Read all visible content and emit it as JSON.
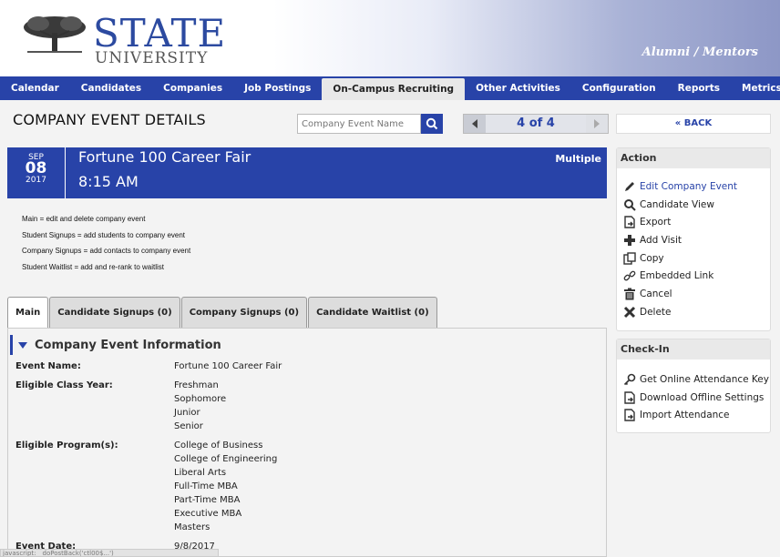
{
  "header": {
    "logo_main": "STATE",
    "logo_sub": "UNIVERSITY",
    "portal_name": "Alumni / Mentors"
  },
  "nav": {
    "items": [
      "Calendar",
      "Candidates",
      "Companies",
      "Job Postings",
      "On-Campus Recruiting",
      "Other Activities",
      "Configuration",
      "Reports",
      "Metrics"
    ],
    "active": "On-Campus Recruiting"
  },
  "page": {
    "title": "COMPANY EVENT DETAILS",
    "search_placeholder": "Company Event Name",
    "pager_text": "4 of 4",
    "back_label": "« BACK"
  },
  "event": {
    "month": "SEP",
    "day": "08",
    "year": "2017",
    "title": "Fortune 100 Career Fair",
    "time": "8:15 AM",
    "badge": "Multiple"
  },
  "legend": [
    "Main = edit and delete company event",
    "Student Signups = add students to company event",
    "Company Signups = add contacts to company event",
    "Student Waitlist = add and re-rank to waitlist"
  ],
  "tabs": [
    "Main",
    "Candidate Signups (0)",
    "Company Signups (0)",
    "Candidate Waitlist (0)"
  ],
  "section": {
    "title": "Company Event Information",
    "fields": {
      "event_name_label": "Event Name:",
      "event_name": "Fortune 100 Career Fair",
      "class_year_label": "Eligible Class Year:",
      "class_years": [
        "Freshman",
        "Sophomore",
        "Junior",
        "Senior"
      ],
      "programs_label": "Eligible Program(s):",
      "programs": [
        "College of Business",
        "College of Engineering",
        "Liberal Arts",
        "Full-Time MBA",
        "Part-Time MBA",
        "Executive MBA",
        "Masters"
      ],
      "event_date_label": "Event Date:",
      "event_date": "9/8/2017"
    }
  },
  "status_text": "javascript:__doPostBack('ctl00$...')",
  "action_panel": {
    "title": "Action",
    "items": [
      {
        "label": "Edit Company Event",
        "icon": "pencil-icon"
      },
      {
        "label": "Candidate View",
        "icon": "magnifier-icon"
      },
      {
        "label": "Export",
        "icon": "export-icon"
      },
      {
        "label": "Add Visit",
        "icon": "plus-icon"
      },
      {
        "label": "Copy",
        "icon": "copy-icon"
      },
      {
        "label": "Embedded Link",
        "icon": "link-icon"
      },
      {
        "label": "Cancel",
        "icon": "trash-icon"
      },
      {
        "label": "Delete",
        "icon": "x-icon"
      }
    ]
  },
  "checkin_panel": {
    "title": "Check-In",
    "items": [
      {
        "label": "Get Online Attendance Key",
        "icon": "key-icon"
      },
      {
        "label": "Download Offline Settings",
        "icon": "download-icon"
      },
      {
        "label": "Import Attendance",
        "icon": "import-icon"
      }
    ]
  },
  "colors": {
    "primary": "#2843a8",
    "panel_bg": "#ffffff",
    "page_bg": "#f3f3f3"
  }
}
